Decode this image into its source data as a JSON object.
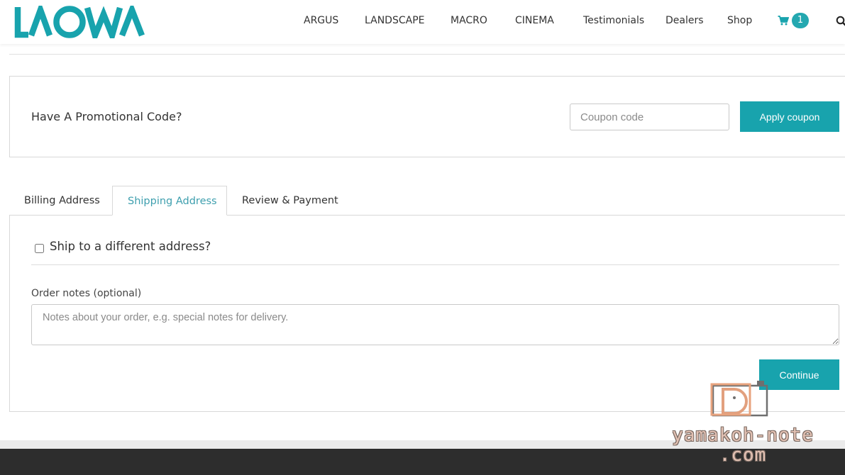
{
  "brand": {
    "logo_text": "LAOWA",
    "accent": "#18a3ad"
  },
  "nav": {
    "items": [
      "ARGUS",
      "LANDSCAPE",
      "MACRO",
      "CINEMA",
      "Testimonials",
      "Dealers",
      "Shop"
    ],
    "cart_count": "1",
    "cart_icon": "cart-icon",
    "search_icon": "search-icon"
  },
  "coupon": {
    "title": "Have A Promotional Code?",
    "placeholder": "Coupon code",
    "value": "",
    "apply_label": "Apply coupon"
  },
  "tabs": [
    {
      "label": "Billing Address",
      "active": false
    },
    {
      "label": "Shipping Address",
      "active": true
    },
    {
      "label": "Review & Payment",
      "active": false
    }
  ],
  "shipping": {
    "checkbox_label": "Ship to a different address?",
    "checked": false,
    "notes_label": "Order notes (optional)",
    "notes_placeholder": "Notes about your order, e.g. special notes for delivery.",
    "notes_value": "",
    "continue_label": "Continue"
  },
  "watermark": {
    "line1": "yamakoh-note",
    "line2": ".com"
  }
}
